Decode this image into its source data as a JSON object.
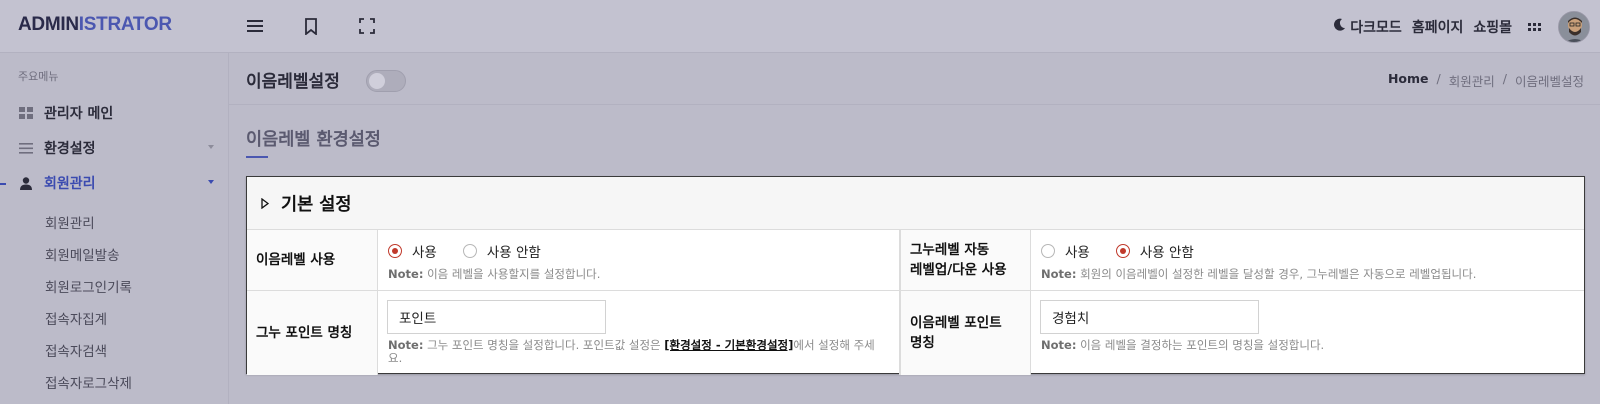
{
  "topbar": {
    "logo_part1": "ADMIN",
    "logo_part2": "ISTRATOR",
    "icons": [
      "menu-icon",
      "bookmark-icon",
      "fullscreen-icon"
    ],
    "darkmode_label": "다크모드",
    "homepage_label": "홈페이지",
    "shop_label": "쇼핑몰",
    "apps_icon": "grid-icon"
  },
  "sidebar": {
    "header": "주요메뉴",
    "items": [
      {
        "label": "관리자 메인",
        "icon": "dashboard-icon"
      },
      {
        "label": "환경설정",
        "icon": "settings-lines-icon"
      },
      {
        "label": "회원관리",
        "icon": "user-icon"
      }
    ],
    "sub_items": [
      "회원관리",
      "회원메일발송",
      "회원로그인기록",
      "접속자집계",
      "접속자검색",
      "접속자로그삭제"
    ]
  },
  "pagebar": {
    "title": "이음레벨설정",
    "breadcrumb": [
      "Home",
      "회원관리",
      "이음레벨설정"
    ],
    "separator": "/"
  },
  "section": {
    "title": "이음레벨 환경설정"
  },
  "card": {
    "title": "기본 설정",
    "rows": {
      "use_label": "이음레벨 사용",
      "use_options": [
        "사용",
        "사용 안함"
      ],
      "use_selected": "사용",
      "use_note_prefix": "Note:",
      "use_note": "이음 레벨을 사용할지를 설정합니다.",
      "auto_label_line1": "그누레벨 자동",
      "auto_label_line2": "레벨업/다운 사용",
      "auto_options": [
        "사용",
        "사용 안함"
      ],
      "auto_selected": "사용 안함",
      "auto_note_prefix": "Note:",
      "auto_note": "회원의 이음레벨이 설정한 레벨을 달성할 경우, 그누레벨은 자동으로 레벨업됩니다.",
      "point_label": "그누 포인트 명칭",
      "point_value": "포인트",
      "point_note_prefix": "Note:",
      "point_note_a": "그누 포인트 명칭을 설정합니다. 포인트값 설정은",
      "point_note_link": "[환경설정 - 기본환경설정]",
      "point_note_b": "에서 설정해 주세",
      "point_note_c": "요.",
      "exp_label_line1": "이음레벨 포인트",
      "exp_label_line2": "명칭",
      "exp_value": "경험치",
      "exp_note_prefix": "Note:",
      "exp_note": "이음 레벨을 결정하는 포인트의 명칭을 설정합니다."
    }
  },
  "colors": {
    "accent": "#4b57b0",
    "radio_checked": "#c0392b",
    "overlay_bg": "#bcbbc9"
  }
}
